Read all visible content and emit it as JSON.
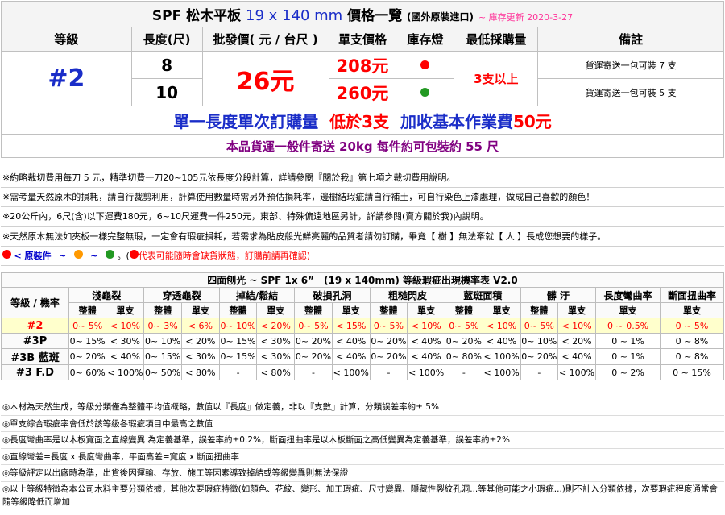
{
  "title": {
    "main": "SPF 松木平板",
    "dims": "19 x 140 mm",
    "tail": "價格一覽",
    "origin": "(國外原裝進口)",
    "updated": "~ 庫存更新 2020-3-27"
  },
  "headers": {
    "grade": "等級",
    "length": "長度(尺)",
    "wholesale": "批發價( 元 / 台尺 )",
    "piece_price": "單支價格",
    "stock": "庫存燈",
    "moq": "最低採購量",
    "remark": "備註"
  },
  "product": {
    "grade": "#2",
    "wholesale_price": "26元",
    "moq": "3支以上",
    "rows": [
      {
        "length": "8",
        "price": "208元",
        "stock_color": "#ff0000",
        "remark": "貨運寄送一包可裝 7 支"
      },
      {
        "length": "10",
        "price": "260元",
        "stock_color": "#229922",
        "remark": "貨運寄送一包可裝 5 支"
      }
    ]
  },
  "min_order": {
    "part1": "單一長度單次訂購量",
    "part2": "低於3支",
    "part3": "加收基本作業費",
    "part4": "50元"
  },
  "ship_note": "本品貨運一般件寄送 20kg 每件約可包裝約 55 尺",
  "notes": [
    "※約略裁切費用每刀 5 元，精準切費一刀20~105元依長度分段計算，詳請參閱『關於我』第七項之裁切費用說明。",
    "※需考量天然原木的損耗，請自行裁剪利用，計算使用數量時需另外預估損耗率，邊樹結瑕疵請自行補土，可自行染色上漆處理，做成自己喜歡的顏色！",
    "※20公斤內，6尺(含)以下運費180元，6~10尺運費一件250元，東部、特殊偏遠地區另計，詳請參閱(賣方關於我)內說明。",
    "※天然原木無法如夾板一樣完整無瑕，一定會有瑕疵損耗，若需求為貼皮般光鮮亮麗的品質者請勿訂購，畢竟【 樹 】無法牽就【 人 】長成您想要的樣子。"
  ],
  "legend": {
    "label": "< 原裝件",
    "tilde": "~",
    "colors": [
      "#ff0000",
      "#ff9900",
      "#229922"
    ],
    "warn_prefix": "。(",
    "warn_text": "代表可能隨時會缺貨狀態，訂購前請再確認)"
  },
  "defect_table": {
    "title": "四面刨光 ~ SPF 1x 6”　(19 x 140mm) 等級瑕疵出現機率表 V2.0",
    "grade_header": "等級 / 機率",
    "groups": [
      "淺龜裂",
      "穿透龜裂",
      "掉結/鬆結",
      "破損孔洞",
      "粗糙閃皮",
      "藍斑面積",
      "髒 汙",
      "長度彎曲率",
      "斷面扭曲率"
    ],
    "sub_whole": "整體",
    "sub_single": "單支",
    "rows": [
      {
        "grade": "#2",
        "cells": [
          "0~ 5%",
          "< 10%",
          "0~ 3%",
          "< 6%",
          "0~ 10%",
          "< 20%",
          "0~ 5%",
          "< 15%",
          "0~ 5%",
          "< 10%",
          "0~ 5%",
          "< 10%",
          "0~ 5%",
          "< 10%",
          "0 ~ 0.5%",
          "0 ~ 5%"
        ]
      },
      {
        "grade": "#3P",
        "cells": [
          "0~ 15%",
          "< 30%",
          "0~ 10%",
          "< 20%",
          "0~ 15%",
          "< 30%",
          "0~ 20%",
          "< 40%",
          "0~ 20%",
          "< 40%",
          "0~ 20%",
          "< 40%",
          "0~ 10%",
          "< 20%",
          "0 ~ 1%",
          "0 ~ 8%"
        ]
      },
      {
        "grade": "#3B 藍斑",
        "cells": [
          "0~ 20%",
          "< 40%",
          "0~ 15%",
          "< 30%",
          "0~ 15%",
          "< 30%",
          "0~ 20%",
          "< 40%",
          "0~ 20%",
          "< 40%",
          "0~ 80%",
          "< 100%",
          "0~ 20%",
          "< 40%",
          "0 ~ 1%",
          "0 ~ 8%"
        ]
      },
      {
        "grade": "#3 F.D",
        "cells": [
          "0~ 60%",
          "< 100%",
          "0~ 50%",
          "< 80%",
          "-",
          "< 80%",
          "-",
          "< 100%",
          "-",
          "< 100%",
          "-",
          "< 100%",
          "-",
          "< 100%",
          "0 ~ 2%",
          "0 ~ 15%"
        ]
      }
    ]
  },
  "footnotes": [
    "◎木材為天然生成，等級分類僅為整體平均值概略，數值以『長度』做定義，非以『支數』計算，分類誤差率約± 5%",
    "◎單支綜合瑕疵率會低於該等級各瑕疵項目中最高之數值",
    "◎長度彎曲率是以木板寬面之直線變異 為定義基準，誤差率約±0.2%，斷面扭曲率是以木板斷面之高低變異為定義基準，誤差率約±2%",
    "◎直線彎差=長度 x 長度彎曲率，平面高差=寬度 x 斷面扭曲率",
    "◎等級評定以出廠時為準，出貨後因運輸、存放、施工等因素導致掉結或等級變異則無法保證",
    "◎以上等級特徵為本公司木料主要分類依據，其他次要瑕疵特徵(如顏色、花紋、變形、加工瑕疵、尺寸變異、隱藏性裂紋孔洞...等其他可能之小瑕疵...)則不計入分類依據，次要瑕疵程度通常會隨等級降低而增加"
  ]
}
